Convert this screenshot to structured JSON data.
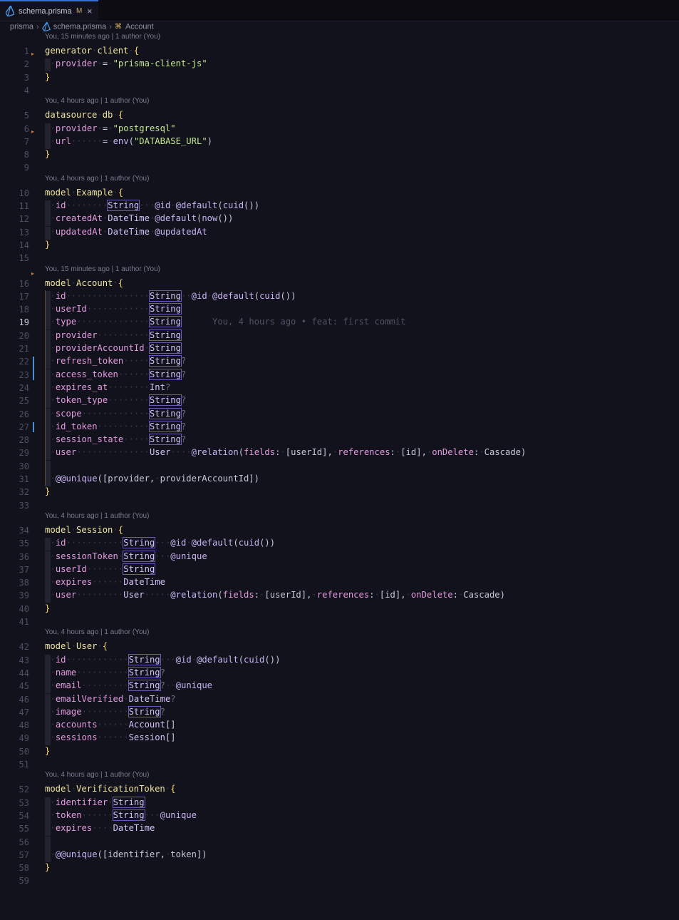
{
  "tab": {
    "filename": "schema.prisma",
    "status": "M",
    "close": "×"
  },
  "breadcrumb": {
    "folder": "prisma",
    "file": "schema.prisma",
    "symbol": "Account"
  },
  "ghost_blame": "You, 4 hours ago • feat: first commit",
  "rows": [
    {
      "t": "lens",
      "text": "You, 15 minutes ago | 1 author (You)"
    },
    {
      "t": "code",
      "n": 1,
      "html": "<span class='kw'>generator</span><span class='dot'>·</span><span class='kw'>client</span><span class='dot'>·</span><span class='br'>{</span>"
    },
    {
      "t": "code",
      "n": 2,
      "html": "<span class='indent'></span><span class='dot'>·</span><span class='prop'>provider</span><span class='dot'>·</span><span class='punc'>=</span><span class='dot'>·</span><span class='str'>\"prisma-client-js\"</span>"
    },
    {
      "t": "code",
      "n": 3,
      "html": "<span class='br'>}</span>"
    },
    {
      "t": "code",
      "n": 4,
      "html": ""
    },
    {
      "t": "lens",
      "text": "You, 4 hours ago | 1 author (You)"
    },
    {
      "t": "code",
      "n": 5,
      "html": "<span class='kw'>datasource</span><span class='dot'>·</span><span class='kw'>db</span><span class='dot'>·</span><span class='br'>{</span>"
    },
    {
      "t": "code",
      "n": 6,
      "html": "<span class='indent'></span><span class='dot'>·</span><span class='prop'>provider</span><span class='dot'>·</span><span class='punc'>=</span><span class='dot'>·</span><span class='str'>\"postgresql\"</span>"
    },
    {
      "t": "code",
      "n": 7,
      "html": "<span class='indent'></span><span class='dot'>·</span><span class='prop'>url</span><span class='dot'>······</span><span class='punc'>=</span><span class='dot'>·</span><span class='fn'>env</span><span class='punc'>(</span><span class='str'>\"DATABASE_URL\"</span><span class='punc'>)</span>"
    },
    {
      "t": "code",
      "n": 8,
      "html": "<span class='br'>}</span>"
    },
    {
      "t": "code",
      "n": 9,
      "html": ""
    },
    {
      "t": "lens",
      "text": "You, 4 hours ago | 1 author (You)"
    },
    {
      "t": "code",
      "n": 10,
      "html": "<span class='kw'>model</span><span class='dot'>·</span><span class='kw'>Example</span><span class='dot'>·</span><span class='br'>{</span>"
    },
    {
      "t": "code",
      "n": 11,
      "html": "<span class='indent'></span><span class='dot'>·</span><span class='prop'>id</span><span class='dot'>········</span><span class='type box'>String</span><span class='dot'>···</span><span class='attr'>@id</span><span class='dot'>·</span><span class='attr'>@default</span><span class='punc'>(</span><span class='fn'>cuid</span><span class='punc'>())</span>"
    },
    {
      "t": "code",
      "n": 12,
      "html": "<span class='indent'></span><span class='dot'>·</span><span class='prop'>createdAt</span><span class='dot'>·</span><span class='type'>DateTime</span><span class='dot'>·</span><span class='attr'>@default</span><span class='punc'>(</span><span class='fn'>now</span><span class='punc'>())</span>"
    },
    {
      "t": "code",
      "n": 13,
      "html": "<span class='indent'></span><span class='dot'>·</span><span class='prop'>updatedAt</span><span class='dot'>·</span><span class='type'>DateTime</span><span class='dot'>·</span><span class='attr'>@updatedAt</span>"
    },
    {
      "t": "code",
      "n": 14,
      "html": "<span class='br'>}</span>"
    },
    {
      "t": "code",
      "n": 15,
      "html": ""
    },
    {
      "t": "lens",
      "text": "You, 15 minutes ago | 1 author (You)"
    },
    {
      "t": "code",
      "n": 16,
      "html": "<span class='kw'>model</span><span class='dot'>·</span><span class='kw'>Account</span><span class='dot'>·</span><span class='br'>{</span>"
    },
    {
      "t": "code",
      "n": 17,
      "html": "<span class='indent'></span><span class='dot'>·</span><span class='prop'>id</span><span class='dot'>················</span><span class='type box'>String</span><span class='dot'>··</span><span class='attr'>@id</span><span class='dot'>·</span><span class='attr'>@default</span><span class='punc'>(</span><span class='fn'>cuid</span><span class='punc'>())</span>"
    },
    {
      "t": "code",
      "n": 18,
      "html": "<span class='indent'></span><span class='dot'>·</span><span class='prop'>userId</span><span class='dot'>············</span><span class='type box'>String</span>"
    },
    {
      "t": "code",
      "n": 19,
      "active": true,
      "ghost": true,
      "html": "<span class='indent'></span><span class='dot'>·</span><span class='prop'>type</span><span class='dot'>··············</span><span class='type box'>String</span><span class='ghost'>      </span>"
    },
    {
      "t": "code",
      "n": 20,
      "html": "<span class='indent'></span><span class='dot'>·</span><span class='prop'>provider</span><span class='dot'>··········</span><span class='type box'>String</span>"
    },
    {
      "t": "code",
      "n": 21,
      "html": "<span class='indent'></span><span class='dot'>·</span><span class='prop'>providerAccountId</span><span class='dot'>·</span><span class='type box'>String</span>"
    },
    {
      "t": "code",
      "n": 22,
      "html": "<span class='indent'></span><span class='dot'>·</span><span class='prop'>refresh_token</span><span class='dot'>·····</span><span class='type box'>String</span><span class='opt'>?</span>"
    },
    {
      "t": "code",
      "n": 23,
      "html": "<span class='indent'></span><span class='dot'>·</span><span class='prop'>access_token</span><span class='dot'>······</span><span class='type box'>String</span><span class='opt'>?</span>"
    },
    {
      "t": "code",
      "n": 24,
      "html": "<span class='indent'></span><span class='dot'>·</span><span class='prop'>expires_at</span><span class='dot'>········</span><span class='type'>Int</span><span class='opt'>?</span>"
    },
    {
      "t": "code",
      "n": 25,
      "html": "<span class='indent'></span><span class='dot'>·</span><span class='prop'>token_type</span><span class='dot'>········</span><span class='type box'>String</span><span class='opt'>?</span>"
    },
    {
      "t": "code",
      "n": 26,
      "html": "<span class='indent'></span><span class='dot'>·</span><span class='prop'>scope</span><span class='dot'>·············</span><span class='type box'>String</span><span class='opt'>?</span>"
    },
    {
      "t": "code",
      "n": 27,
      "html": "<span class='indent'></span><span class='dot'>·</span><span class='prop'>id_token</span><span class='dot'>··········</span><span class='type box'>String</span><span class='opt'>?</span>"
    },
    {
      "t": "code",
      "n": 28,
      "html": "<span class='indent'></span><span class='dot'>·</span><span class='prop'>session_state</span><span class='dot'>·····</span><span class='type box'>String</span><span class='opt'>?</span>"
    },
    {
      "t": "code",
      "n": 29,
      "html": "<span class='indent'></span><span class='dot'>·</span><span class='prop'>user</span><span class='dot'>··············</span><span class='type'>User</span><span class='dot'>····</span><span class='attr'>@relation</span><span class='punc'>(</span><span class='key'>fields</span><span class='punc'>:</span><span class='dot'>·</span><span class='punc'>[userId],</span><span class='dot'>·</span><span class='key'>references</span><span class='punc'>:</span><span class='dot'>·</span><span class='punc'>[id],</span><span class='dot'>·</span><span class='key'>onDelete</span><span class='punc'>:</span><span class='dot'>·</span><span class='punc'>Cascade)</span>"
    },
    {
      "t": "code",
      "n": 30,
      "html": "<span class='indent'></span>"
    },
    {
      "t": "code",
      "n": 31,
      "html": "<span class='indent'></span><span class='dot'>·</span><span class='attr'>@@unique</span><span class='punc'>([provider,</span><span class='dot'>·</span><span class='punc'>providerAccountId])</span>"
    },
    {
      "t": "code",
      "n": 32,
      "html": "<span class='br'>}</span>"
    },
    {
      "t": "code",
      "n": 33,
      "html": ""
    },
    {
      "t": "lens",
      "text": "You, 4 hours ago | 1 author (You)"
    },
    {
      "t": "code",
      "n": 34,
      "html": "<span class='kw'>model</span><span class='dot'>·</span><span class='kw'>Session</span><span class='dot'>·</span><span class='br'>{</span>"
    },
    {
      "t": "code",
      "n": 35,
      "html": "<span class='indent'></span><span class='dot'>·</span><span class='prop'>id</span><span class='dot'>···········</span><span class='type box'>String</span><span class='dot'>···</span><span class='attr'>@id</span><span class='dot'>·</span><span class='attr'>@default</span><span class='punc'>(</span><span class='fn'>cuid</span><span class='punc'>())</span>"
    },
    {
      "t": "code",
      "n": 36,
      "html": "<span class='indent'></span><span class='dot'>·</span><span class='prop'>sessionToken</span><span class='dot'>·</span><span class='type box'>String</span><span class='dot'>···</span><span class='attr'>@unique</span>"
    },
    {
      "t": "code",
      "n": 37,
      "html": "<span class='indent'></span><span class='dot'>·</span><span class='prop'>userId</span><span class='dot'>·······</span><span class='type box'>String</span>"
    },
    {
      "t": "code",
      "n": 38,
      "html": "<span class='indent'></span><span class='dot'>·</span><span class='prop'>expires</span><span class='dot'>······</span><span class='type'>DateTime</span>"
    },
    {
      "t": "code",
      "n": 39,
      "html": "<span class='indent'></span><span class='dot'>·</span><span class='prop'>user</span><span class='dot'>·········</span><span class='type'>User</span><span class='dot'>·····</span><span class='attr'>@relation</span><span class='punc'>(</span><span class='key'>fields</span><span class='punc'>:</span><span class='dot'>·</span><span class='punc'>[userId],</span><span class='dot'>·</span><span class='key'>references</span><span class='punc'>:</span><span class='dot'>·</span><span class='punc'>[id],</span><span class='dot'>·</span><span class='key'>onDelete</span><span class='punc'>:</span><span class='dot'>·</span><span class='punc'>Cascade)</span>"
    },
    {
      "t": "code",
      "n": 40,
      "html": "<span class='br'>}</span>"
    },
    {
      "t": "code",
      "n": 41,
      "html": ""
    },
    {
      "t": "lens",
      "text": "You, 4 hours ago | 1 author (You)"
    },
    {
      "t": "code",
      "n": 42,
      "html": "<span class='kw'>model</span><span class='dot'>·</span><span class='kw'>User</span><span class='dot'>·</span><span class='br'>{</span>"
    },
    {
      "t": "code",
      "n": 43,
      "html": "<span class='indent'></span><span class='dot'>·</span><span class='prop'>id</span><span class='dot'>············</span><span class='type box'>String</span><span class='dot'>···</span><span class='attr'>@id</span><span class='dot'>·</span><span class='attr'>@default</span><span class='punc'>(</span><span class='fn'>cuid</span><span class='punc'>())</span>"
    },
    {
      "t": "code",
      "n": 44,
      "html": "<span class='indent'></span><span class='dot'>·</span><span class='prop'>name</span><span class='dot'>··········</span><span class='type box'>String</span><span class='opt'>?</span>"
    },
    {
      "t": "code",
      "n": 45,
      "html": "<span class='indent'></span><span class='dot'>·</span><span class='prop'>email</span><span class='dot'>·········</span><span class='type box'>String</span><span class='opt'>?</span><span class='dot'>··</span><span class='attr'>@unique</span>"
    },
    {
      "t": "code",
      "n": 46,
      "html": "<span class='indent'></span><span class='dot'>·</span><span class='prop'>emailVerified</span><span class='dot'>·</span><span class='type'>DateTime</span><span class='opt'>?</span>"
    },
    {
      "t": "code",
      "n": 47,
      "html": "<span class='indent'></span><span class='dot'>·</span><span class='prop'>image</span><span class='dot'>·········</span><span class='type box'>String</span><span class='opt'>?</span>"
    },
    {
      "t": "code",
      "n": 48,
      "html": "<span class='indent'></span><span class='dot'>·</span><span class='prop'>accounts</span><span class='dot'>······</span><span class='type'>Account</span><span class='punc'>[]</span>"
    },
    {
      "t": "code",
      "n": 49,
      "html": "<span class='indent'></span><span class='dot'>·</span><span class='prop'>sessions</span><span class='dot'>······</span><span class='type'>Session</span><span class='punc'>[]</span>"
    },
    {
      "t": "code",
      "n": 50,
      "html": "<span class='br'>}</span>"
    },
    {
      "t": "code",
      "n": 51,
      "html": ""
    },
    {
      "t": "lens",
      "text": "You, 4 hours ago | 1 author (You)"
    },
    {
      "t": "code",
      "n": 52,
      "html": "<span class='kw'>model</span><span class='dot'>·</span><span class='kw'>VerificationToken</span><span class='dot'>·</span><span class='br'>{</span>"
    },
    {
      "t": "code",
      "n": 53,
      "html": "<span class='indent'></span><span class='dot'>·</span><span class='prop'>identifier</span><span class='dot'>·</span><span class='type box'>String</span>"
    },
    {
      "t": "code",
      "n": 54,
      "html": "<span class='indent'></span><span class='dot'>·</span><span class='prop'>token</span><span class='dot'>······</span><span class='type box'>String</span><span class='dot'>···</span><span class='attr'>@unique</span>"
    },
    {
      "t": "code",
      "n": 55,
      "html": "<span class='indent'></span><span class='dot'>·</span><span class='prop'>expires</span><span class='dot'>····</span><span class='type'>DateTime</span>"
    },
    {
      "t": "code",
      "n": 56,
      "html": "<span class='indent'></span>"
    },
    {
      "t": "code",
      "n": 57,
      "html": "<span class='indent'></span><span class='dot'>·</span><span class='attr'>@@unique</span><span class='punc'>([identifier,</span><span class='dot'>·</span><span class='punc'>token])</span>"
    },
    {
      "t": "code",
      "n": 58,
      "html": "<span class='br'>}</span>"
    },
    {
      "t": "code",
      "n": 59,
      "html": ""
    }
  ]
}
